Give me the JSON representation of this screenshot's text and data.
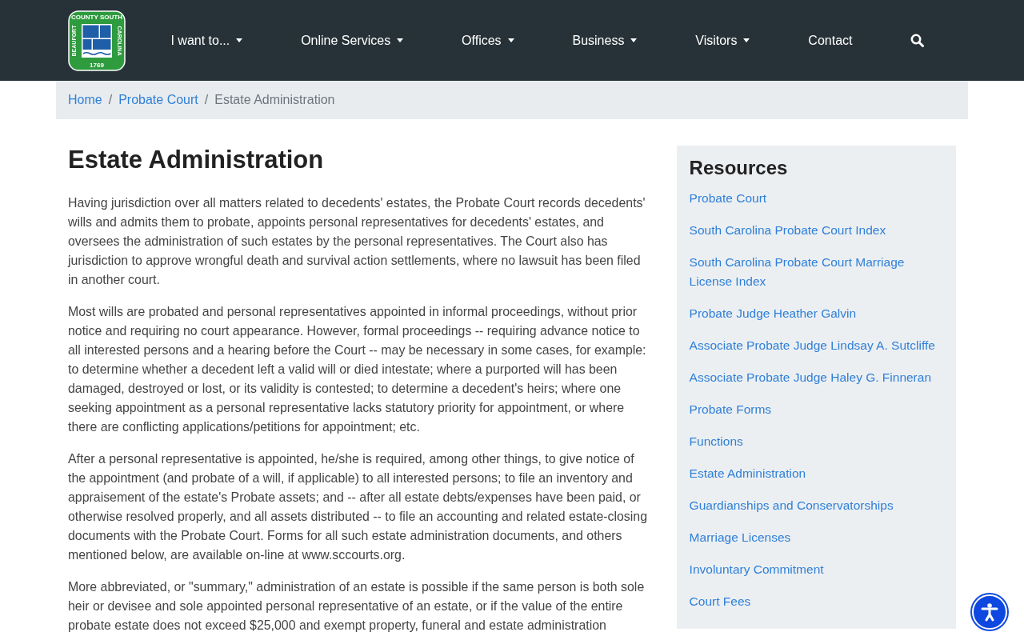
{
  "logo": {
    "left_text": "BEAUFORT",
    "top_text": "COUNTY SOUTH",
    "right_text": "CAROLINA",
    "year": "1769"
  },
  "nav": [
    {
      "label": "I want to...",
      "dropdown": true
    },
    {
      "label": "Online Services",
      "dropdown": true
    },
    {
      "label": "Offices",
      "dropdown": true
    },
    {
      "label": "Business",
      "dropdown": true
    },
    {
      "label": "Visitors",
      "dropdown": true
    },
    {
      "label": "Contact",
      "dropdown": false
    }
  ],
  "breadcrumb": [
    {
      "label": "Home",
      "link": true
    },
    {
      "label": "Probate Court",
      "link": true
    },
    {
      "label": "Estate Administration",
      "link": false
    }
  ],
  "breadcrumb_separator": "/",
  "title": "Estate Administration",
  "paragraphs": [
    "Having jurisdiction over all matters related to decedents' estates, the Probate Court records decedents' wills and admits them to probate, appoints personal representatives for decedents' estates, and oversees the administration of such estates by the personal representatives. The Court also has jurisdiction to approve wrongful death and survival action settlements, where no lawsuit has been filed in another court.",
    "Most wills are probated and personal representatives appointed in informal proceedings, without prior notice and requiring no court appearance. However, formal proceedings -- requiring advance notice to all interested persons and a hearing before the Court -- may be necessary in some cases, for example: to determine whether a decedent left a valid will or died intestate; where a purported will has been damaged, destroyed or lost, or its validity is contested; to determine a decedent's heirs; where one seeking appointment as a personal representative lacks statutory priority for appointment, or where there are conflicting applications/petitions for appointment; etc.",
    "After a personal representative is appointed, he/she is required, among other things, to give notice of the appointment (and probate of a will, if applicable) to all interested persons; to file an inventory and appraisement of the estate's Probate assets; and -- after all estate debts/expenses have been paid, or otherwise resolved properly, and all assets distributed -- to file an accounting and related estate-closing documents with the Probate Court. Forms for all such estate administration documents, and others mentioned below, are available on-line at www.sccourts.org.",
    "More abbreviated, or \"summary,\" administration of an estate is possible if the same person is both sole heir or devisee and sole appointed personal representative of an estate, or if the value of the entire probate estate does not exceed $25,000 and exempt property, funeral and estate administration"
  ],
  "sidebar": {
    "title": "Resources",
    "links": [
      "Probate Court",
      "South Carolina Probate Court Index",
      "South Carolina Probate Court Marriage License Index",
      "Probate Judge Heather Galvin",
      "Associate Probate Judge Lindsay A. Sutcliffe",
      "Associate Probate Judge Haley G. Finneran",
      "Probate Forms",
      "Functions",
      "Estate Administration",
      "Guardianships and Conservatorships",
      "Marriage Licenses",
      "Involuntary Commitment",
      "Court Fees"
    ]
  }
}
